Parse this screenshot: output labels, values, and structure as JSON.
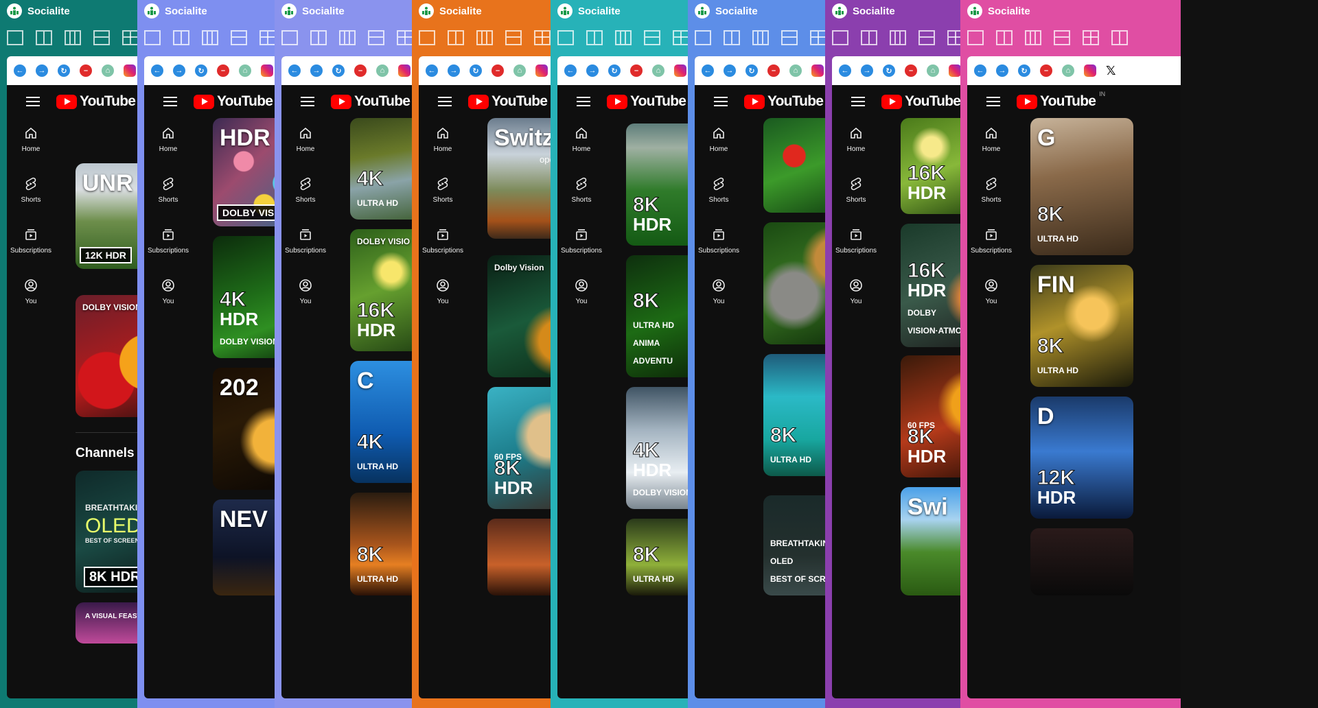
{
  "app_name": "Socialite",
  "youtube": {
    "logo_text": "YouTube",
    "country": "IN",
    "sidebar": [
      {
        "label": "Home",
        "icon": "home-icon"
      },
      {
        "label": "Shorts",
        "icon": "shorts-icon"
      },
      {
        "label": "Subscriptions",
        "icon": "subscriptions-icon"
      },
      {
        "label": "You",
        "icon": "you-icon"
      }
    ]
  },
  "browser_icons": [
    "back-icon",
    "forward-icon",
    "refresh-icon",
    "stop-icon",
    "home-icon",
    "instagram-icon",
    "x-icon"
  ],
  "layout_icons": [
    "single-layout-icon",
    "two-column-layout-icon",
    "three-column-layout-icon",
    "two-row-layout-icon",
    "grid-layout-icon",
    "split-layout-icon"
  ],
  "panels": [
    {
      "theme_color": "#0e7a72",
      "thumbnails": [
        {
          "label": "UNR",
          "badge": "12K HDR"
        },
        {
          "label": "DOLBY VISION"
        }
      ],
      "section_title": "Channels new t",
      "more_thumbnails": [
        {
          "lines": [
            "BREATHTAKING",
            "OLED",
            "BEST OF SCREEN TEST"
          ],
          "badge": "8K HDR"
        },
        {
          "label": "A VISUAL FEAST OF OLED"
        }
      ]
    },
    {
      "theme_color": "#7e8ff0",
      "thumbnails": [
        {
          "label": "HDR",
          "badge": "DOLBY VISION"
        },
        {
          "lines": [
            "4K",
            "HDR",
            "DOLBY VISION"
          ]
        },
        {
          "label": "202"
        },
        {
          "label": "NEV"
        }
      ]
    },
    {
      "theme_color": "#8a93ee",
      "thumbnails": [
        {
          "lines": [
            "4K",
            "ULTRA HD"
          ]
        },
        {
          "label": "DOLBY VISIO",
          "lines": [
            "16K",
            "HDR"
          ]
        },
        {
          "lines": [
            "4K",
            "ULTRA HD"
          ],
          "label": "C"
        },
        {
          "lines": [
            "8K",
            "ULTRA HD"
          ]
        }
      ]
    },
    {
      "theme_color": "#e8731c",
      "thumbnails": [
        {
          "label": "Switz",
          "sublabel": "open"
        },
        {
          "label": "Dolby Vision"
        },
        {
          "lines": [
            "60 FPS",
            "8K",
            "HDR"
          ]
        },
        {
          "label": ""
        }
      ]
    },
    {
      "theme_color": "#27b2b8",
      "thumbnails": [
        {
          "lines": [
            "8K",
            "HDR"
          ]
        },
        {
          "lines": [
            "8K",
            "ULTRA HD",
            "ANIMA",
            "ADVENTU"
          ]
        },
        {
          "lines": [
            "4K",
            "HDR",
            "DOLBY VISION"
          ]
        },
        {
          "lines": [
            "8K",
            "ULTRA HD"
          ]
        }
      ]
    },
    {
      "theme_color": "#5d8ee8",
      "thumbnails": [
        {
          "label": ""
        },
        {
          "label": ""
        },
        {
          "lines": [
            "8K",
            "ULTRA HD"
          ]
        },
        {
          "lines": [
            "BREATHTAKING",
            "OLED",
            "BEST OF SCREEN TEST"
          ]
        }
      ]
    },
    {
      "theme_color": "#8b3fae",
      "thumbnails": [
        {
          "lines": [
            "16K",
            "HDR"
          ]
        },
        {
          "lines": [
            "16K",
            "HDR",
            "DOLBY",
            "VISION·ATMOS"
          ]
        },
        {
          "lines": [
            "60 FPS",
            "8K",
            "HDR"
          ]
        },
        {
          "label": "Swi"
        }
      ]
    },
    {
      "theme_color": "#e04ea3",
      "thumbnails": [
        {
          "lines": [
            "8K",
            "ULTRA HD"
          ],
          "label": "G"
        },
        {
          "lines": [
            "8K",
            "ULTRA HD"
          ],
          "label": "FIN"
        },
        {
          "lines": [
            "12K",
            "HDR"
          ],
          "label": "D"
        },
        {
          "label": ""
        }
      ]
    }
  ]
}
